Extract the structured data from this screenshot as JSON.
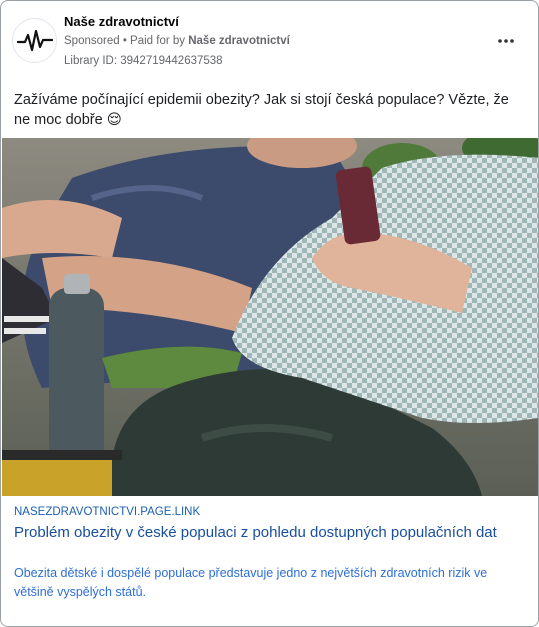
{
  "header": {
    "page_name": "Naše zdravotnictví",
    "sponsored_label": "Sponsored",
    "paid_for_prefix": " • Paid for by ",
    "paid_for_name": "Naše zdravotnictví",
    "library_id": "Library ID: 3942719442637538",
    "avatar_icon": "heartbeat-icon",
    "more_icon": "more-options-icon"
  },
  "post": {
    "text": "Zažíváme počínající epidemii obezity? Jak si stojí česká populace? Vězte, že ne moc dobře 😌"
  },
  "link_preview": {
    "domain": "NASEZDRAVOTNICTVI.PAGE.LINK",
    "title": "Problém obezity v české populaci z pohledu dostupných populačních dat",
    "description": "Obezita dětské i dospělé populace představuje jedno z největších zdravotních rizik ve většině vyspělých států."
  },
  "colors": {
    "link_title": "#1a4fa0",
    "link_desc": "#2d6fd6",
    "muted": "#65676b"
  }
}
